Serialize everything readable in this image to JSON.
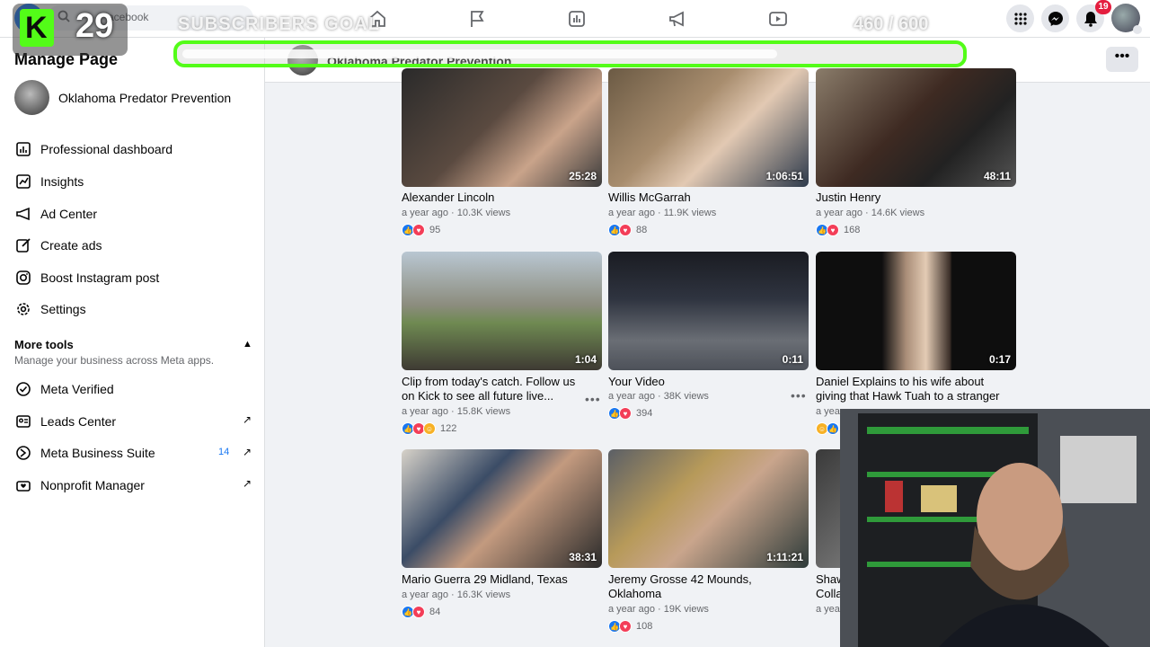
{
  "topbar": {
    "search_placeholder": "Search Facebook",
    "search_visible_text": "acebook",
    "notifications_count": "19",
    "nav_icons": [
      "home-icon",
      "flag-icon",
      "chart-icon",
      "megaphone-icon",
      "video-icon"
    ],
    "right_icons": [
      "menu-grid-icon",
      "messenger-icon",
      "bell-icon"
    ]
  },
  "subheader": {
    "page_name": "Oklahoma Predator Prevention",
    "more_label": "•••"
  },
  "sidebar": {
    "title": "Manage Page",
    "page_name": "Oklahoma Predator Prevention",
    "items": [
      {
        "label": "Professional dashboard",
        "icon": "dashboard-icon"
      },
      {
        "label": "Insights",
        "icon": "insights-icon"
      },
      {
        "label": "Ad Center",
        "icon": "megaphone-icon"
      },
      {
        "label": "Create ads",
        "icon": "pencil-icon"
      },
      {
        "label": "Boost Instagram post",
        "icon": "instagram-icon"
      },
      {
        "label": "Settings",
        "icon": "gear-icon"
      }
    ],
    "more_tools": {
      "title": "More tools",
      "subtitle": "Manage your business across Meta apps.",
      "items": [
        {
          "label": "Meta Verified",
          "icon": "verified-icon"
        },
        {
          "label": "Leads Center",
          "icon": "leads-icon"
        },
        {
          "label": "Meta Business Suite",
          "icon": "business-suite-icon",
          "badge": "14"
        },
        {
          "label": "Nonprofit Manager",
          "icon": "nonprofit-icon"
        }
      ]
    }
  },
  "videos": [
    {
      "title": "Alexander Lincoln",
      "meta": "a year ago · 10.3K views",
      "reactions": "95",
      "duration": "25:28"
    },
    {
      "title": "Willis McGarrah",
      "meta": "a year ago · 11.9K views",
      "reactions": "88",
      "duration": "1:06:51"
    },
    {
      "title": "Justin Henry",
      "meta": "a year ago · 14.6K views",
      "reactions": "168",
      "duration": "48:11"
    },
    {
      "title": "Clip from today's catch. Follow us on Kick to see all future live...",
      "meta": "a year ago · 15.8K views",
      "reactions": "122",
      "duration": "1:04"
    },
    {
      "title": "Your Video",
      "meta": "a year ago · 38K views",
      "reactions": "394",
      "duration": "0:11"
    },
    {
      "title": "Daniel Explains to his wife about giving that Hawk Tuah to a stranger",
      "meta": "a year a",
      "reactions": "",
      "duration": "0:17"
    },
    {
      "title": "Mario Guerra 29 Midland, Texas",
      "meta": "a year ago · 16.3K views",
      "reactions": "84",
      "duration": "38:31"
    },
    {
      "title": "Jeremy Grosse 42 Mounds, Oklahoma",
      "meta": "a year ago · 19K views",
      "reactions": "108",
      "duration": "1:11:21"
    },
    {
      "title": "Shaw Colla",
      "meta": "a yea",
      "reactions": "",
      "duration": ""
    }
  ],
  "overlay": {
    "kick_letter": "K",
    "kick_count": "29",
    "goal_label": "SUBSCRIBERS GOAL",
    "goal_count": "460  / 600",
    "goal_progress": 0.767
  },
  "colors": {
    "facebook_blue": "#1877f2",
    "kick_green": "#53fc18",
    "notification_red": "#e41e3f"
  }
}
